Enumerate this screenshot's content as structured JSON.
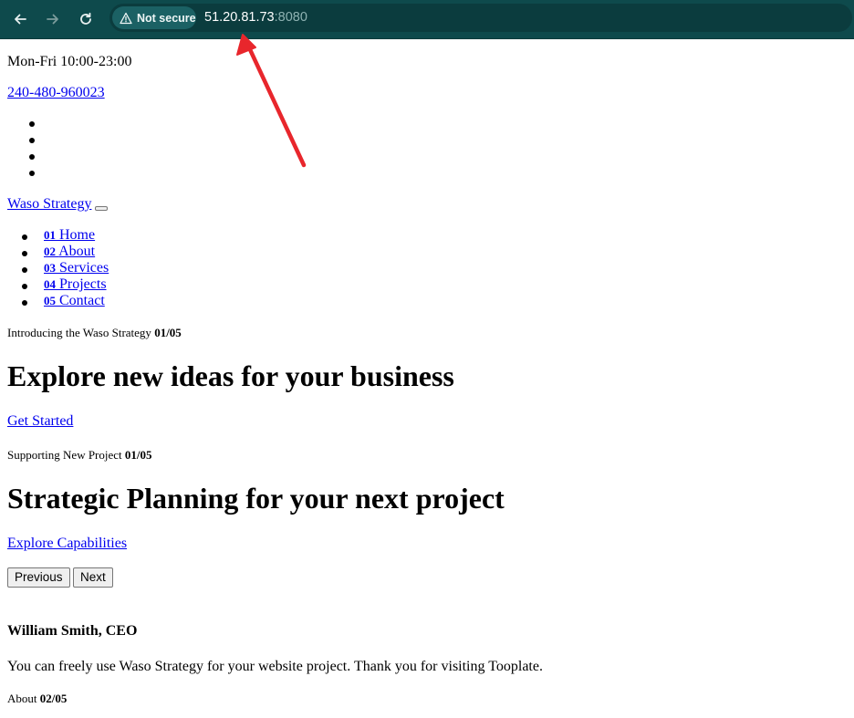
{
  "browser": {
    "security_label": "Not secure",
    "url_host": "51.20.81.73",
    "url_port": ":8080",
    "icons": {
      "back": "arrow-left-icon",
      "forward": "arrow-right-icon",
      "reload": "reload-icon",
      "warning": "warning-triangle-icon"
    }
  },
  "topinfo": {
    "hours": "Mon-Fri 10:00-23:00",
    "phone": "240-480-960023"
  },
  "brand": "Waso Strategy",
  "menu": [
    {
      "num": "01",
      "label": "Home"
    },
    {
      "num": "02",
      "label": "About"
    },
    {
      "num": "03",
      "label": "Services"
    },
    {
      "num": "04",
      "label": "Projects"
    },
    {
      "num": "05",
      "label": "Contact"
    }
  ],
  "slides": [
    {
      "kicker": "Introducing the Waso Strategy",
      "index": "01/05",
      "title": "Explore new ideas for your business",
      "cta": "Get Started"
    },
    {
      "kicker": "Supporting New Project",
      "index": "01/05",
      "title": "Strategic Planning for your next project",
      "cta": "Explore Capabilities"
    }
  ],
  "carousel": {
    "prev": "Previous",
    "next": "Next"
  },
  "about": {
    "author": "William Smith, CEO",
    "text": "You can freely use Waso Strategy for your website project. Thank you for visiting Tooplate.",
    "section": "About",
    "index": "02/05"
  },
  "colors": {
    "toolbar": "#0e4a4c",
    "link": "#0000ee",
    "annotation": "#e8262c"
  }
}
